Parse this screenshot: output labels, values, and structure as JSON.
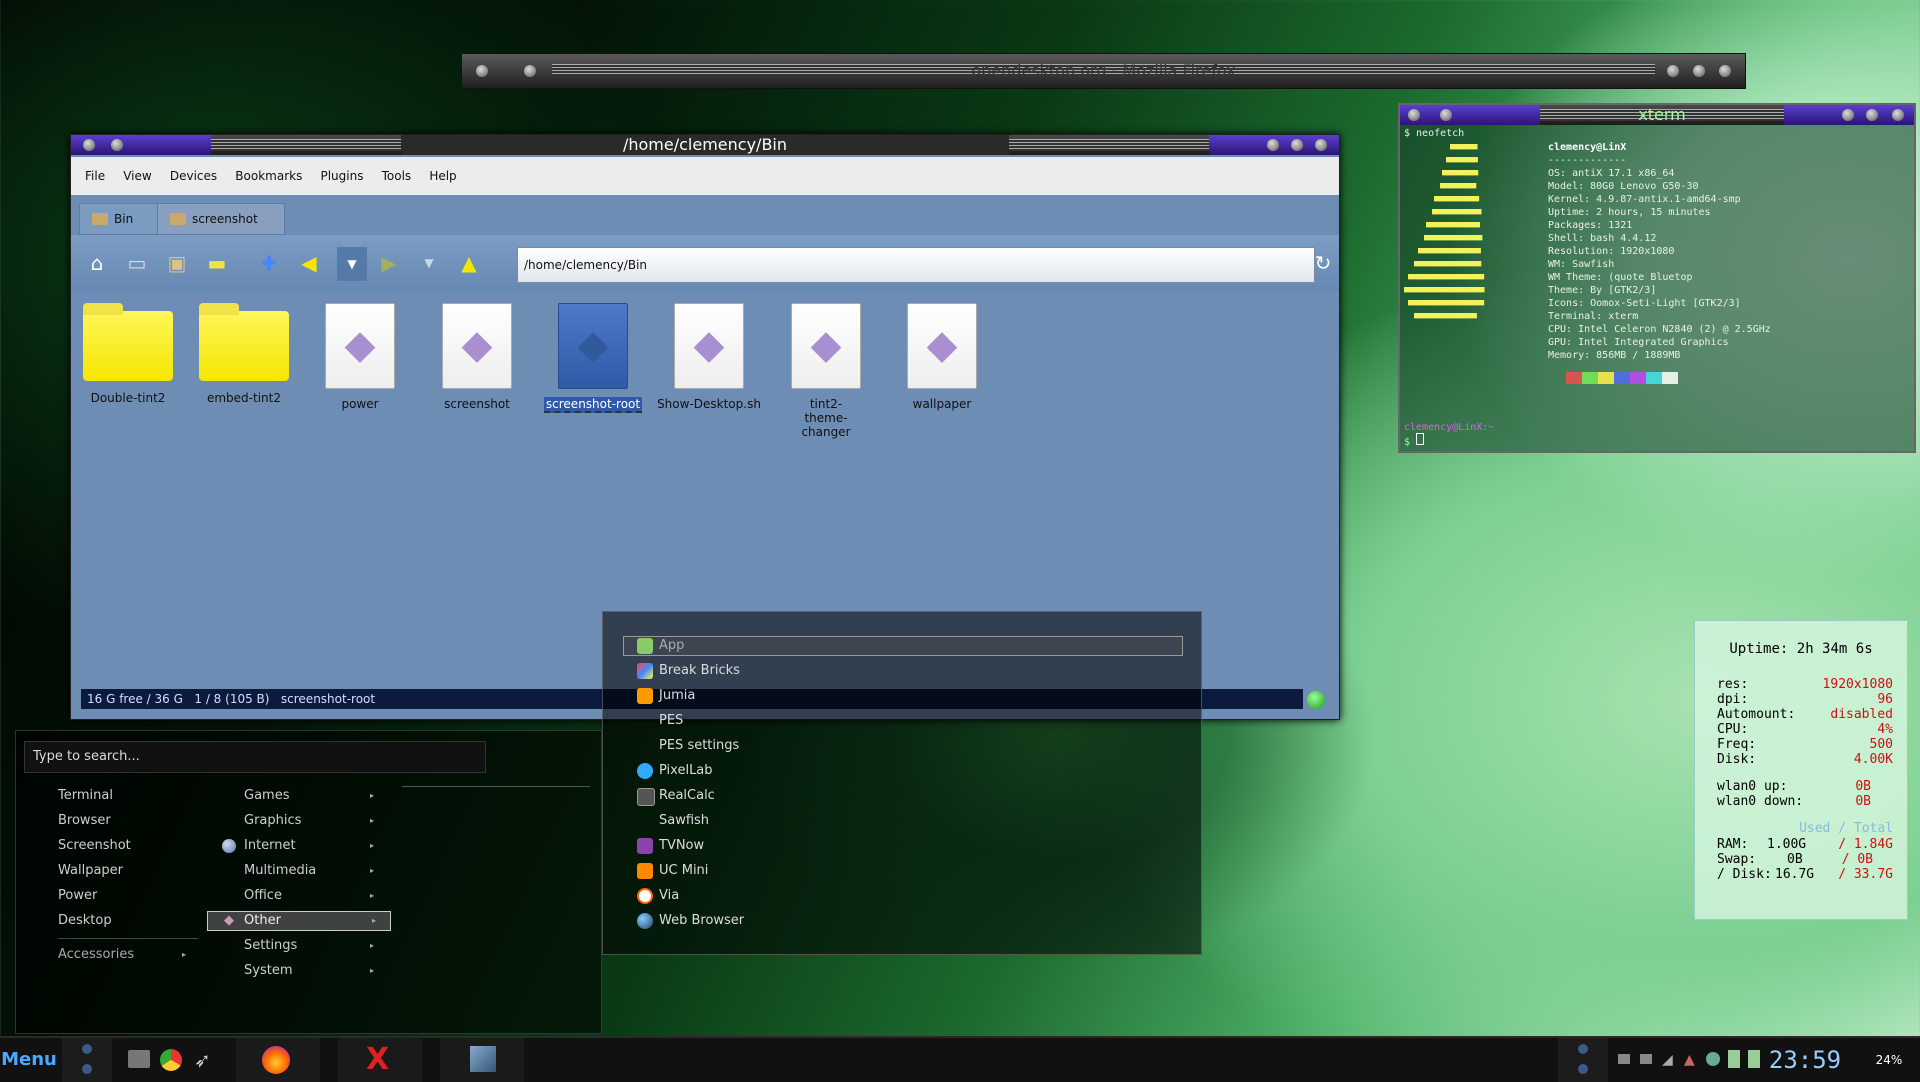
{
  "firefox": {
    "title": "opendesktop.org - Mozilla Firefox"
  },
  "filemanager": {
    "title": "/home/clemency/Bin",
    "menu": [
      "File",
      "View",
      "Devices",
      "Bookmarks",
      "Plugins",
      "Tools",
      "Help"
    ],
    "tabs": [
      "Bin",
      "screenshot"
    ],
    "address": "/home/clemency/Bin",
    "files": [
      {
        "name": "Double-tint2",
        "type": "folder"
      },
      {
        "name": "embed-tint2",
        "type": "folder"
      },
      {
        "name": "power",
        "type": "doc"
      },
      {
        "name": "screenshot",
        "type": "doc"
      },
      {
        "name": "screenshot-root",
        "type": "doc-selected"
      },
      {
        "name": "Show-Desktop.sh",
        "type": "doc"
      },
      {
        "name": "tint2-theme-changer",
        "type": "doc"
      },
      {
        "name": "wallpaper",
        "type": "doc"
      }
    ],
    "status": {
      "free": "16 G free / 36 G",
      "sel": "1 / 8 (105 B)",
      "name": "screenshot-root"
    }
  },
  "xterm": {
    "title": "xterm",
    "prompt_cmd": "$ neofetch",
    "header": "clemency@LinX",
    "sep": "-------------",
    "info": [
      "OS: antiX 17.1 x86_64",
      "Model: 80G0 Lenovo G50-30",
      "Kernel: 4.9.87-antix.1-amd64-smp",
      "Uptime: 2 hours, 15 minutes",
      "Packages: 1321",
      "Shell: bash 4.4.12",
      "Resolution: 1920x1080",
      "WM: Sawfish",
      "WM Theme: (quote Bluetop",
      "Theme: By [GTK2/3]",
      "Icons: Oomox-Seti-Light [GTK2/3]",
      "Terminal: xterm",
      "CPU: Intel Celeron N2840 (2) @ 2.5GHz",
      "GPU: Intel Integrated Graphics",
      "Memory: 856MB / 1889MB"
    ],
    "prompt_end": "clemency@LinX:~",
    "prompt_sym": "$",
    "colors": [
      "#d9534f",
      "#6fdc5a",
      "#e7e14a",
      "#4f6fe0",
      "#b34fe0",
      "#46d6d6",
      "#e6efe6"
    ]
  },
  "conky": {
    "uptime": "Uptime: 2h 34m 6s",
    "rows": [
      {
        "k": "res:",
        "v": "1920x1080"
      },
      {
        "k": "dpi:",
        "v": "96"
      },
      {
        "k": "Automount:",
        "v": "disabled"
      },
      {
        "k": "CPU:",
        "v": "4%"
      },
      {
        "k": "Freq:",
        "v": "500"
      },
      {
        "k": "Disk:",
        "v": "4.00K"
      }
    ],
    "net": [
      {
        "k": "wlan0 up:",
        "v": "0B"
      },
      {
        "k": "wlan0 down:",
        "v": "0B"
      }
    ],
    "used_total": "Used / Total",
    "mem": [
      {
        "k": "RAM:",
        "u": "1.00G",
        "t": "/ 1.84G"
      },
      {
        "k": "Swap:",
        "u": "0B",
        "t": "/ 0B"
      },
      {
        "k": "/ Disk:",
        "u": "16.7G",
        "t": "/ 33.7G"
      }
    ]
  },
  "menu": {
    "search_placeholder": "Type to search...",
    "favorites": [
      "Terminal",
      "Browser",
      "Screenshot",
      "Wallpaper",
      "Power",
      "Desktop"
    ],
    "accessories": "Accessories",
    "categories": [
      "Games",
      "Graphics",
      "Internet",
      "Multimedia",
      "Office",
      "Other",
      "Settings",
      "System"
    ],
    "submenu": [
      "App",
      "Break Bricks",
      "Jumia",
      "PES",
      "PES settings",
      "PixelLab",
      "RealCalc",
      "Sawfish",
      "TVNow",
      "UC Mini",
      "Via",
      "Web Browser"
    ]
  },
  "taskbar": {
    "menu": "Menu",
    "clock": "23:59",
    "battery": "24%"
  }
}
